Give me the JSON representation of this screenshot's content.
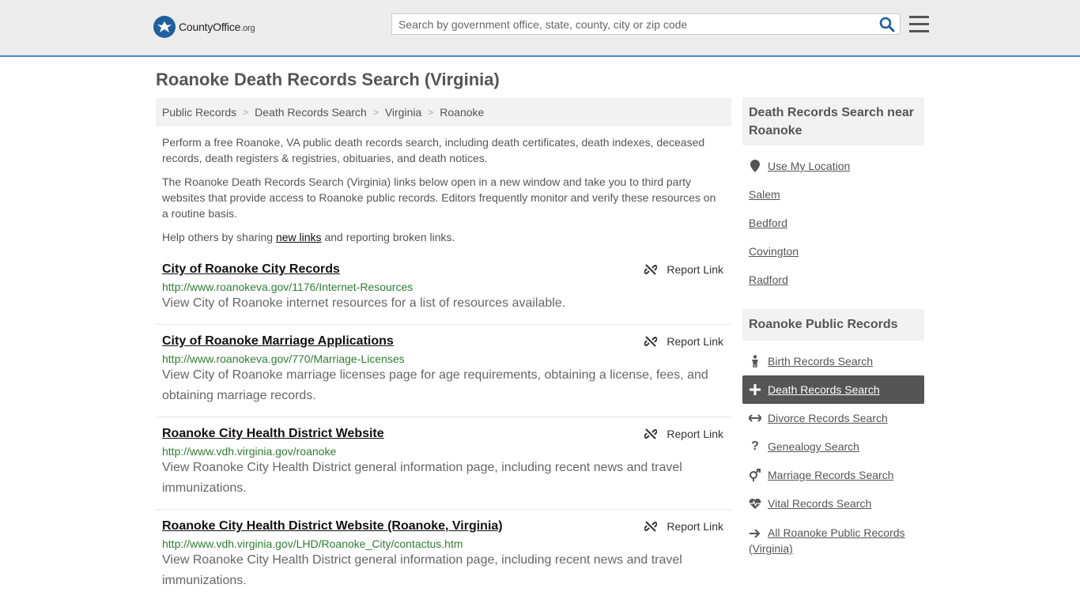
{
  "header": {
    "logo_main": "CountyOffice",
    "logo_suffix": ".org",
    "search_placeholder": "Search by government office, state, county, city or zip code"
  },
  "page": {
    "title": "Roanoke Death Records Search (Virginia)",
    "breadcrumb": [
      "Public Records",
      "Death Records Search",
      "Virginia",
      "Roanoke"
    ],
    "intro1": "Perform a free Roanoke, VA public death records search, including death certificates, death indexes, deceased records, death registers & registries, obituaries, and death notices.",
    "intro2": "The Roanoke Death Records Search (Virginia) links below open in a new window and take you to third party websites that provide access to Roanoke public records. Editors frequently monitor and verify these resources on a routine basis.",
    "help_prefix": "Help others by sharing ",
    "help_link": "new links",
    "help_suffix": " and reporting broken links."
  },
  "report_label": "Report Link",
  "listings": [
    {
      "title": "City of Roanoke City Records",
      "url": "http://www.roanokeva.gov/1176/Internet-Resources",
      "desc": "View City of Roanoke internet resources for a list of resources available."
    },
    {
      "title": "City of Roanoke Marriage Applications",
      "url": "http://www.roanokeva.gov/770/Marriage-Licenses",
      "desc": "View City of Roanoke marriage licenses page for age requirements, obtaining a license, fees, and obtaining marriage records."
    },
    {
      "title": "Roanoke City Health District Website",
      "url": "http://www.vdh.virginia.gov/roanoke",
      "desc": "View Roanoke City Health District general information page, including recent news and travel immunizations."
    },
    {
      "title": "Roanoke City Health District Website (Roanoke, Virginia)",
      "url": "http://www.vdh.virginia.gov/LHD/Roanoke_City/contactus.htm",
      "desc": "View Roanoke City Health District general information page, including recent news and travel immunizations."
    }
  ],
  "sidebar": {
    "nearby_title": "Death Records Search near Roanoke",
    "nearby": [
      "Use My Location",
      "Salem",
      "Bedford",
      "Covington",
      "Radford"
    ],
    "records_title": "Roanoke Public Records",
    "records": [
      {
        "label": "Birth Records Search",
        "icon": "child-icon"
      },
      {
        "label": "Death Records Search",
        "icon": "cross-icon"
      },
      {
        "label": "Divorce Records Search",
        "icon": "arrows-horizontal-icon"
      },
      {
        "label": "Genealogy Search",
        "icon": "question-icon"
      },
      {
        "label": "Marriage Records Search",
        "icon": "gender-icon"
      },
      {
        "label": "Vital Records Search",
        "icon": "heartbeat-icon"
      },
      {
        "label": "All Roanoke Public Records (Virginia)",
        "icon": "arrow-right-icon"
      }
    ],
    "accent": "#555555"
  },
  "colors": {
    "header_bg": "#ececec",
    "header_border": "#4a86c5",
    "url_green": "#2f7d32",
    "logo_blue": "#1f5f9e"
  }
}
